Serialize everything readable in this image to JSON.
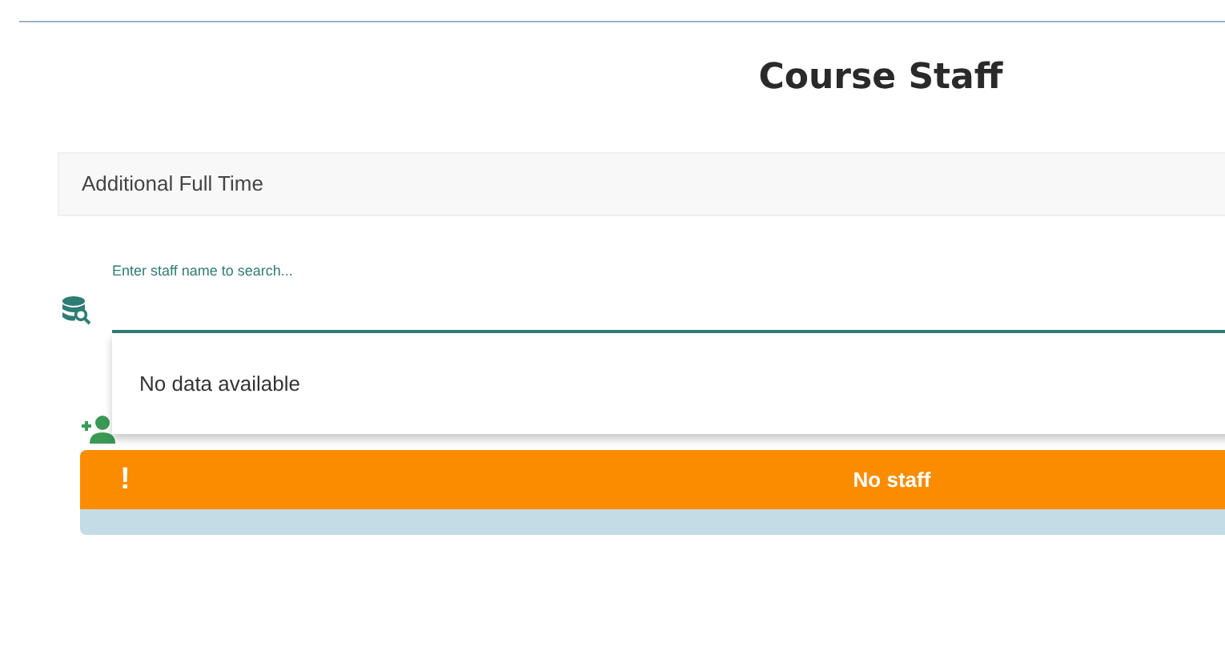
{
  "title": "Course Staff",
  "section": {
    "label": "Additional Full Time"
  },
  "search": {
    "label": "Enter staff name to search...",
    "menu": {
      "expanded": true,
      "message": "No data available"
    }
  },
  "alert": {
    "icon": "!",
    "message": "No staff"
  }
}
